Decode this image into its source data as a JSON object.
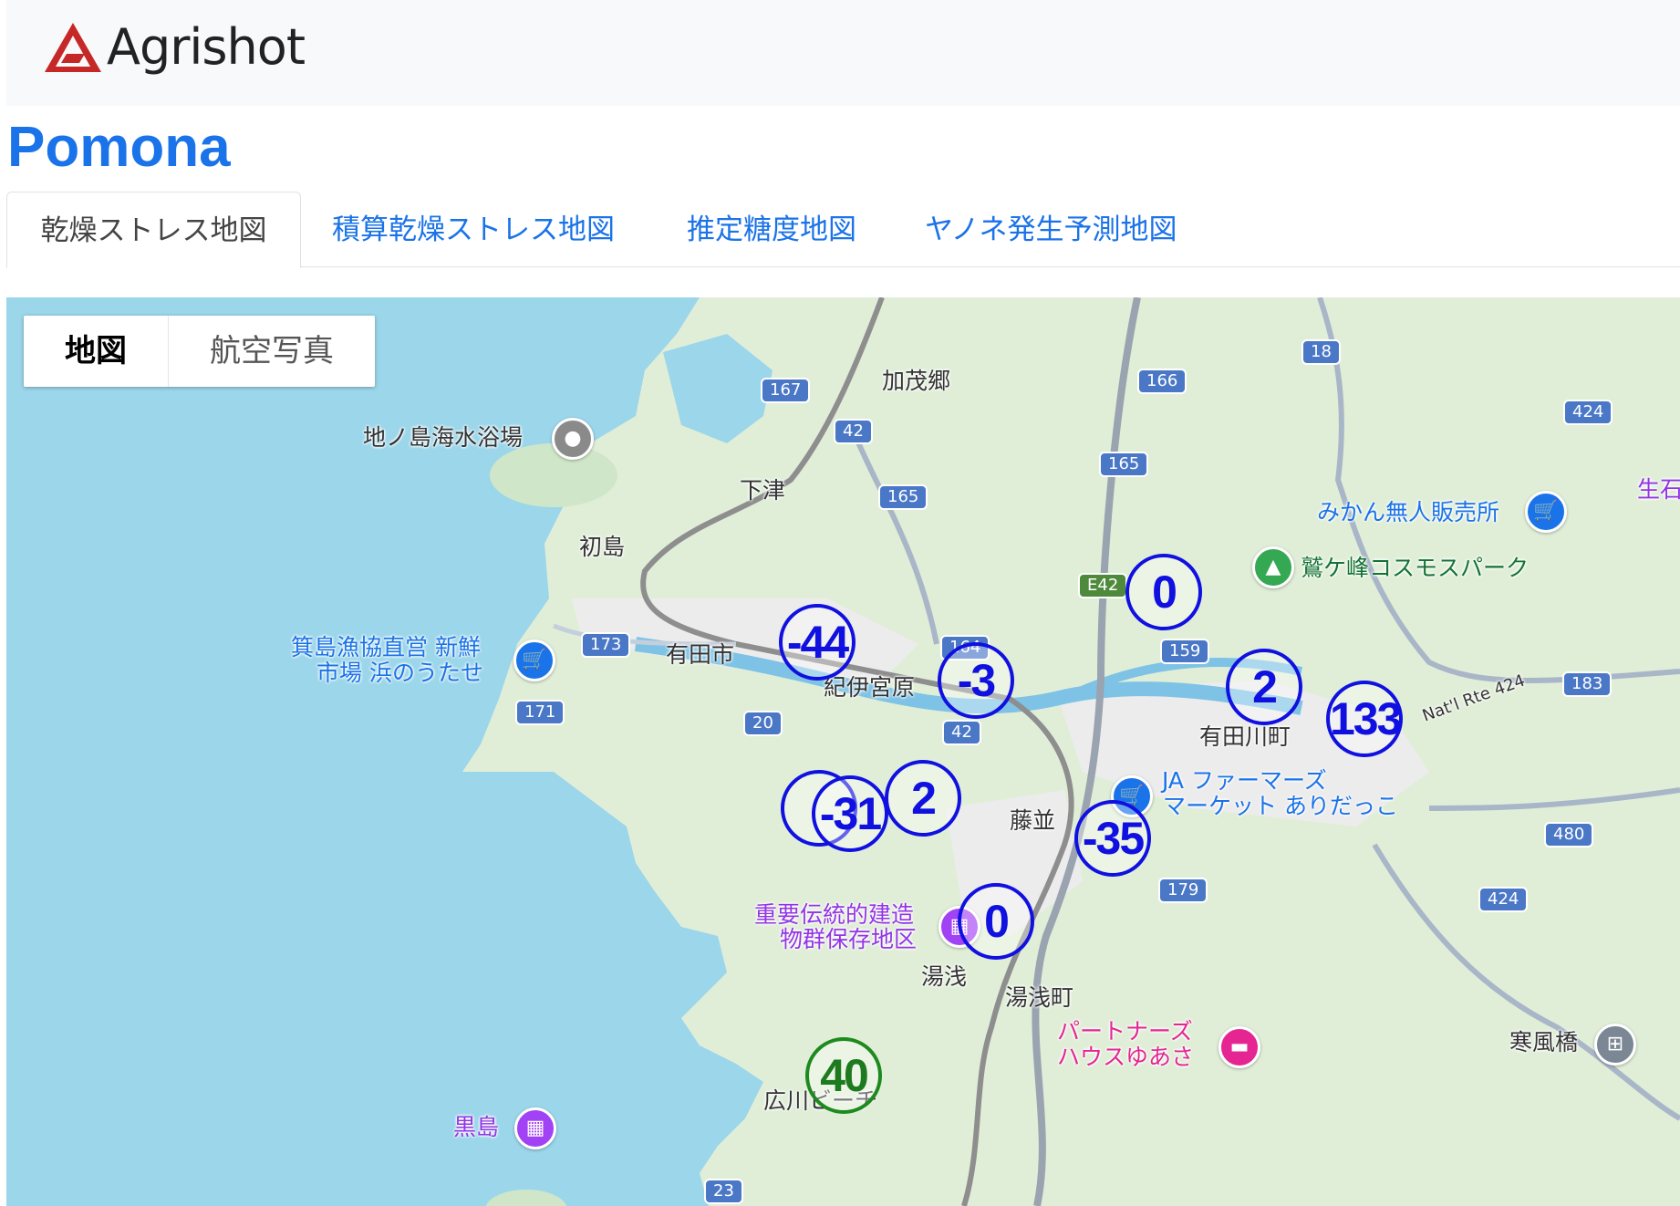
{
  "brand": {
    "name": "Agrishot"
  },
  "page": {
    "title": "Pomona"
  },
  "tabs": [
    {
      "label": "乾燥ストレス地図",
      "active": true
    },
    {
      "label": "積算乾燥ストレス地図",
      "active": false
    },
    {
      "label": "推定糖度地図",
      "active": false
    },
    {
      "label": "ヤノネ発生予測地図",
      "active": false
    }
  ],
  "map_type": {
    "map_label": "地図",
    "satellite_label": "航空写真",
    "selected": "地図"
  },
  "place_labels": [
    "加茂郷",
    "地ノ島海水浴場",
    "下津",
    "初島",
    "有田市",
    "紀伊宮原",
    "箕島漁協直営 新鮮",
    "市場 浜のうたせ",
    "みかん無人販売所",
    "鷲ケ峰コスモスパーク",
    "有田川町",
    "JA ファーマーズ",
    "マーケット ありだっこ",
    "藤並",
    "重要伝統的建造",
    "物群保存地区",
    "湯浅",
    "湯浅町",
    "パートナーズ",
    "ハウスゆあさ",
    "寒風橋",
    "広川ビーチ",
    "黒島",
    "生石",
    "Nat'l Rte 424"
  ],
  "road_shields": [
    "167",
    "42",
    "166",
    "18",
    "424",
    "165",
    "165",
    "E42",
    "173",
    "164",
    "159",
    "171",
    "20",
    "42",
    "183",
    "480",
    "179",
    "424",
    "23"
  ],
  "stress_markers": [
    {
      "value": "0",
      "color": "#1010e0"
    },
    {
      "value": "-44",
      "color": "#1010e0"
    },
    {
      "value": "-3",
      "color": "#1010e0"
    },
    {
      "value": "2",
      "color": "#1010e0"
    },
    {
      "value": "133",
      "color": "#1010e0"
    },
    {
      "value": "-31",
      "color": "#1010e0"
    },
    {
      "value": "2",
      "color": "#1010e0"
    },
    {
      "value": "-35",
      "color": "#1010e0"
    },
    {
      "value": "0",
      "color": "#1010e0"
    },
    {
      "value": "40",
      "color": "#1e8a1e"
    }
  ],
  "colors": {
    "accent": "#1a73e8",
    "marker_blue": "#1010e0",
    "marker_green": "#1e8a1e",
    "water": "#9cd6ea",
    "land": "#e2efdc"
  }
}
